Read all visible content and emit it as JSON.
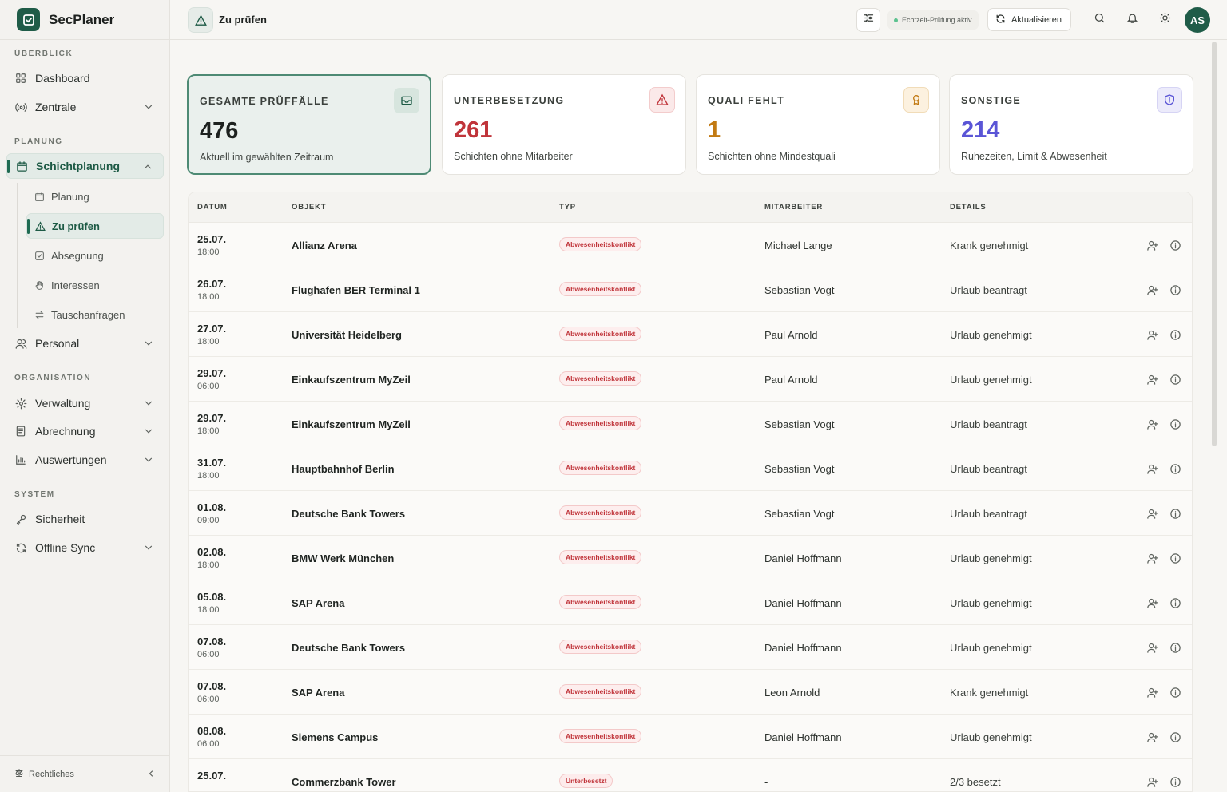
{
  "brand": {
    "name": "SecPlaner"
  },
  "sidebar": {
    "sections": {
      "overview": "ÜBERBLICK",
      "planning": "PLANUNG",
      "organisation": "ORGANISATION",
      "system": "SYSTEM"
    },
    "items": {
      "dashboard": "Dashboard",
      "zentrale": "Zentrale",
      "schichtplanung": "Schichtplanung",
      "planung": "Planung",
      "zu_pruefen": "Zu prüfen",
      "absegnung": "Absegnung",
      "interessen": "Interessen",
      "tauschanfragen": "Tauschanfragen",
      "personal": "Personal",
      "verwaltung": "Verwaltung",
      "abrechnung": "Abrechnung",
      "auswertungen": "Auswertungen",
      "sicherheit": "Sicherheit",
      "offline_sync": "Offline Sync"
    },
    "footer": "Rechtliches"
  },
  "header": {
    "title": "Zu prüfen",
    "live_status": "Echtzeit-Prüfung aktiv",
    "refresh_label": "Aktualisieren",
    "avatar_initials": "AS"
  },
  "cards": [
    {
      "title": "GESAMTE PRÜFFÄLLE",
      "value": "476",
      "desc": "Aktuell im gewählten Zeitraum",
      "color": "#1d211f"
    },
    {
      "title": "UNTERBESETZUNG",
      "value": "261",
      "desc": "Schichten ohne Mitarbeiter",
      "color": "#c0343a"
    },
    {
      "title": "QUALI FEHLT",
      "value": "1",
      "desc": "Schichten ohne Mindestquali",
      "color": "#c27a13"
    },
    {
      "title": "SONSTIGE",
      "value": "214",
      "desc": "Ruhezeiten, Limit & Abwesenheit",
      "color": "#5a55d6"
    }
  ],
  "table": {
    "headers": {
      "datum": "DATUM",
      "objekt": "OBJEKT",
      "typ": "TYP",
      "mitarbeiter": "MITARBEITER",
      "details": "DETAILS"
    },
    "rows": [
      {
        "date": "25.07.",
        "time": "18:00",
        "object": "Allianz Arena",
        "type": "Abwesenheitskonflikt",
        "employee": "Michael Lange",
        "details": "Krank genehmigt"
      },
      {
        "date": "26.07.",
        "time": "18:00",
        "object": "Flughafen BER Terminal 1",
        "type": "Abwesenheitskonflikt",
        "employee": "Sebastian Vogt",
        "details": "Urlaub beantragt"
      },
      {
        "date": "27.07.",
        "time": "18:00",
        "object": "Universität Heidelberg",
        "type": "Abwesenheitskonflikt",
        "employee": "Paul Arnold",
        "details": "Urlaub genehmigt"
      },
      {
        "date": "29.07.",
        "time": "06:00",
        "object": "Einkaufszentrum MyZeil",
        "type": "Abwesenheitskonflikt",
        "employee": "Paul Arnold",
        "details": "Urlaub genehmigt"
      },
      {
        "date": "29.07.",
        "time": "18:00",
        "object": "Einkaufszentrum MyZeil",
        "type": "Abwesenheitskonflikt",
        "employee": "Sebastian Vogt",
        "details": "Urlaub beantragt"
      },
      {
        "date": "31.07.",
        "time": "18:00",
        "object": "Hauptbahnhof Berlin",
        "type": "Abwesenheitskonflikt",
        "employee": "Sebastian Vogt",
        "details": "Urlaub beantragt"
      },
      {
        "date": "01.08.",
        "time": "09:00",
        "object": "Deutsche Bank Towers",
        "type": "Abwesenheitskonflikt",
        "employee": "Sebastian Vogt",
        "details": "Urlaub beantragt"
      },
      {
        "date": "02.08.",
        "time": "18:00",
        "object": "BMW Werk München",
        "type": "Abwesenheitskonflikt",
        "employee": "Daniel Hoffmann",
        "details": "Urlaub genehmigt"
      },
      {
        "date": "05.08.",
        "time": "18:00",
        "object": "SAP Arena",
        "type": "Abwesenheitskonflikt",
        "employee": "Daniel Hoffmann",
        "details": "Urlaub genehmigt"
      },
      {
        "date": "07.08.",
        "time": "06:00",
        "object": "Deutsche Bank Towers",
        "type": "Abwesenheitskonflikt",
        "employee": "Daniel Hoffmann",
        "details": "Urlaub genehmigt"
      },
      {
        "date": "07.08.",
        "time": "06:00",
        "object": "SAP Arena",
        "type": "Abwesenheitskonflikt",
        "employee": "Leon Arnold",
        "details": "Krank genehmigt"
      },
      {
        "date": "08.08.",
        "time": "06:00",
        "object": "Siemens Campus",
        "type": "Abwesenheitskonflikt",
        "employee": "Daniel Hoffmann",
        "details": "Urlaub genehmigt"
      },
      {
        "date": "25.07.",
        "time": "",
        "object": "Commerzbank Tower",
        "type": "Unterbesetzt",
        "employee": "-",
        "details": "2/3 besetzt"
      }
    ]
  }
}
